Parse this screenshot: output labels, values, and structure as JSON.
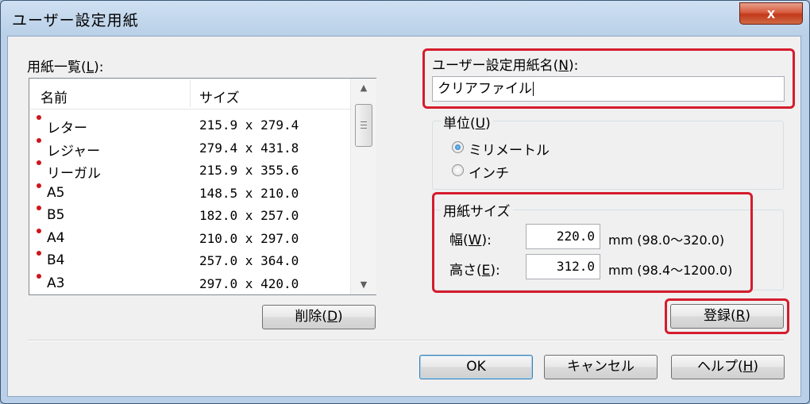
{
  "window": {
    "title": "ユーザー設定用紙",
    "close_label": "x"
  },
  "paper_list": {
    "label_text": "用紙一覧(",
    "label_key": "L",
    "label_suffix": "):",
    "columns": {
      "name": "名前",
      "size": "サイズ"
    },
    "rows": [
      {
        "name": "レター",
        "size": "215.9 x 279.4"
      },
      {
        "name": "レジャー",
        "size": "279.4 x 431.8"
      },
      {
        "name": "リーガル",
        "size": "215.9 x 355.6"
      },
      {
        "name": "A5",
        "size": "148.5 x 210.0"
      },
      {
        "name": "B5",
        "size": "182.0 x 257.0"
      },
      {
        "name": "A4",
        "size": "210.0 x 297.0"
      },
      {
        "name": "B4",
        "size": "257.0 x 364.0"
      },
      {
        "name": "A3",
        "size": "297.0 x 420.0"
      }
    ],
    "scroll_up_icon": "▲",
    "scroll_down_icon": "▼"
  },
  "delete_button": {
    "text": "削除(",
    "key": "D",
    "suffix": ")"
  },
  "paper_name": {
    "label_text": "ユーザー設定用紙名(",
    "label_key": "N",
    "label_suffix": "):",
    "value": "クリアファイル"
  },
  "unit": {
    "title_text": "単位(",
    "title_key": "U",
    "title_suffix": ")",
    "options": [
      {
        "label": "ミリメートル",
        "selected": true
      },
      {
        "label": "インチ",
        "selected": false
      }
    ]
  },
  "paper_size": {
    "title": "用紙サイズ",
    "width": {
      "label_text": "幅(",
      "label_key": "W",
      "label_suffix": "):",
      "value": "220.0",
      "range": "mm (98.0～320.0)"
    },
    "height": {
      "label_text": "高さ(",
      "label_key": "E",
      "label_suffix": "):",
      "value": "312.0",
      "range": "mm (98.4～1200.0)"
    }
  },
  "register_button": {
    "text": "登録(",
    "key": "R",
    "suffix": ")"
  },
  "footer": {
    "ok": "OK",
    "cancel": "キャンセル",
    "help_text": "ヘルプ(",
    "help_key": "H",
    "help_suffix": ")"
  },
  "colors": {
    "highlight": "#d51c2d",
    "bullet": "#d0141a",
    "close_button": "#c2391b"
  }
}
